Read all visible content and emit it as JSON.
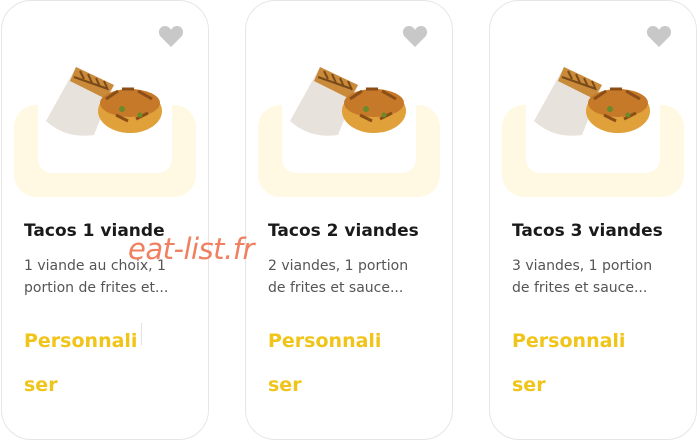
{
  "products": [
    {
      "title": "Tacos 1 viande",
      "desc_line1": "1 viande au choix, 1",
      "desc_line2": "portion de frites et...",
      "cta_line1": "Personnali",
      "cta_line2": "ser"
    },
    {
      "title": "Tacos 2 viandes",
      "desc_line1": "2 viandes, 1 portion",
      "desc_line2": "de frites et sauce...",
      "cta_line1": "Personnali",
      "cta_line2": "ser"
    },
    {
      "title": "Tacos 3 viandes",
      "desc_line1": "3 viandes, 1 portion",
      "desc_line2": "de frites et sauce...",
      "cta_line1": "Personnali",
      "cta_line2": "ser"
    }
  ],
  "watermark": "eat-list.fr",
  "colors": {
    "accent": "#f0c419",
    "tray": "#fff9e3",
    "heart": "#c8c8c8",
    "watermark": "#f08060"
  },
  "icons": {
    "favorite": "heart-icon"
  }
}
